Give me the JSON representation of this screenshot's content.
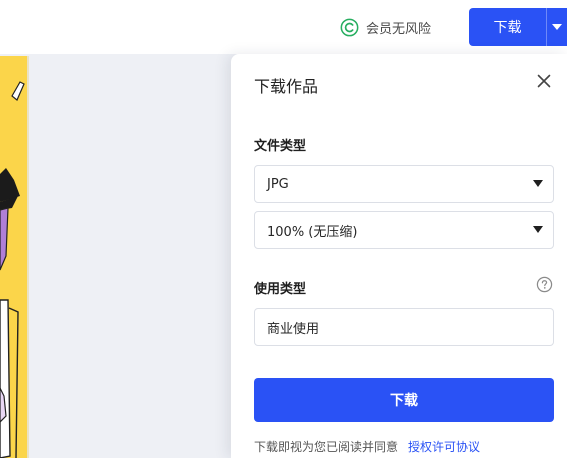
{
  "topbar": {
    "member_badge_label": "会员无风险",
    "download_button_label": "下载",
    "badge_icon": "copyright-circle-icon",
    "dropdown_icon": "caret-down-icon"
  },
  "panel": {
    "title": "下载作品",
    "close_icon": "close-icon",
    "file_type_label": "文件类型",
    "format_value": "JPG",
    "quality_value": "100% (无压缩)",
    "usage_label": "使用类型",
    "usage_help_icon": "question-circle-icon",
    "usage_value": "商业使用",
    "download_label": "下载",
    "agreement_text": "下载即视为您已阅读并同意",
    "agreement_link": "授权许可协议"
  },
  "colors": {
    "accent": "#2a52f5",
    "badge_green": "#27ae60",
    "canvas_bg": "#eef0f5",
    "artwork_yellow": "#fbd54a"
  }
}
